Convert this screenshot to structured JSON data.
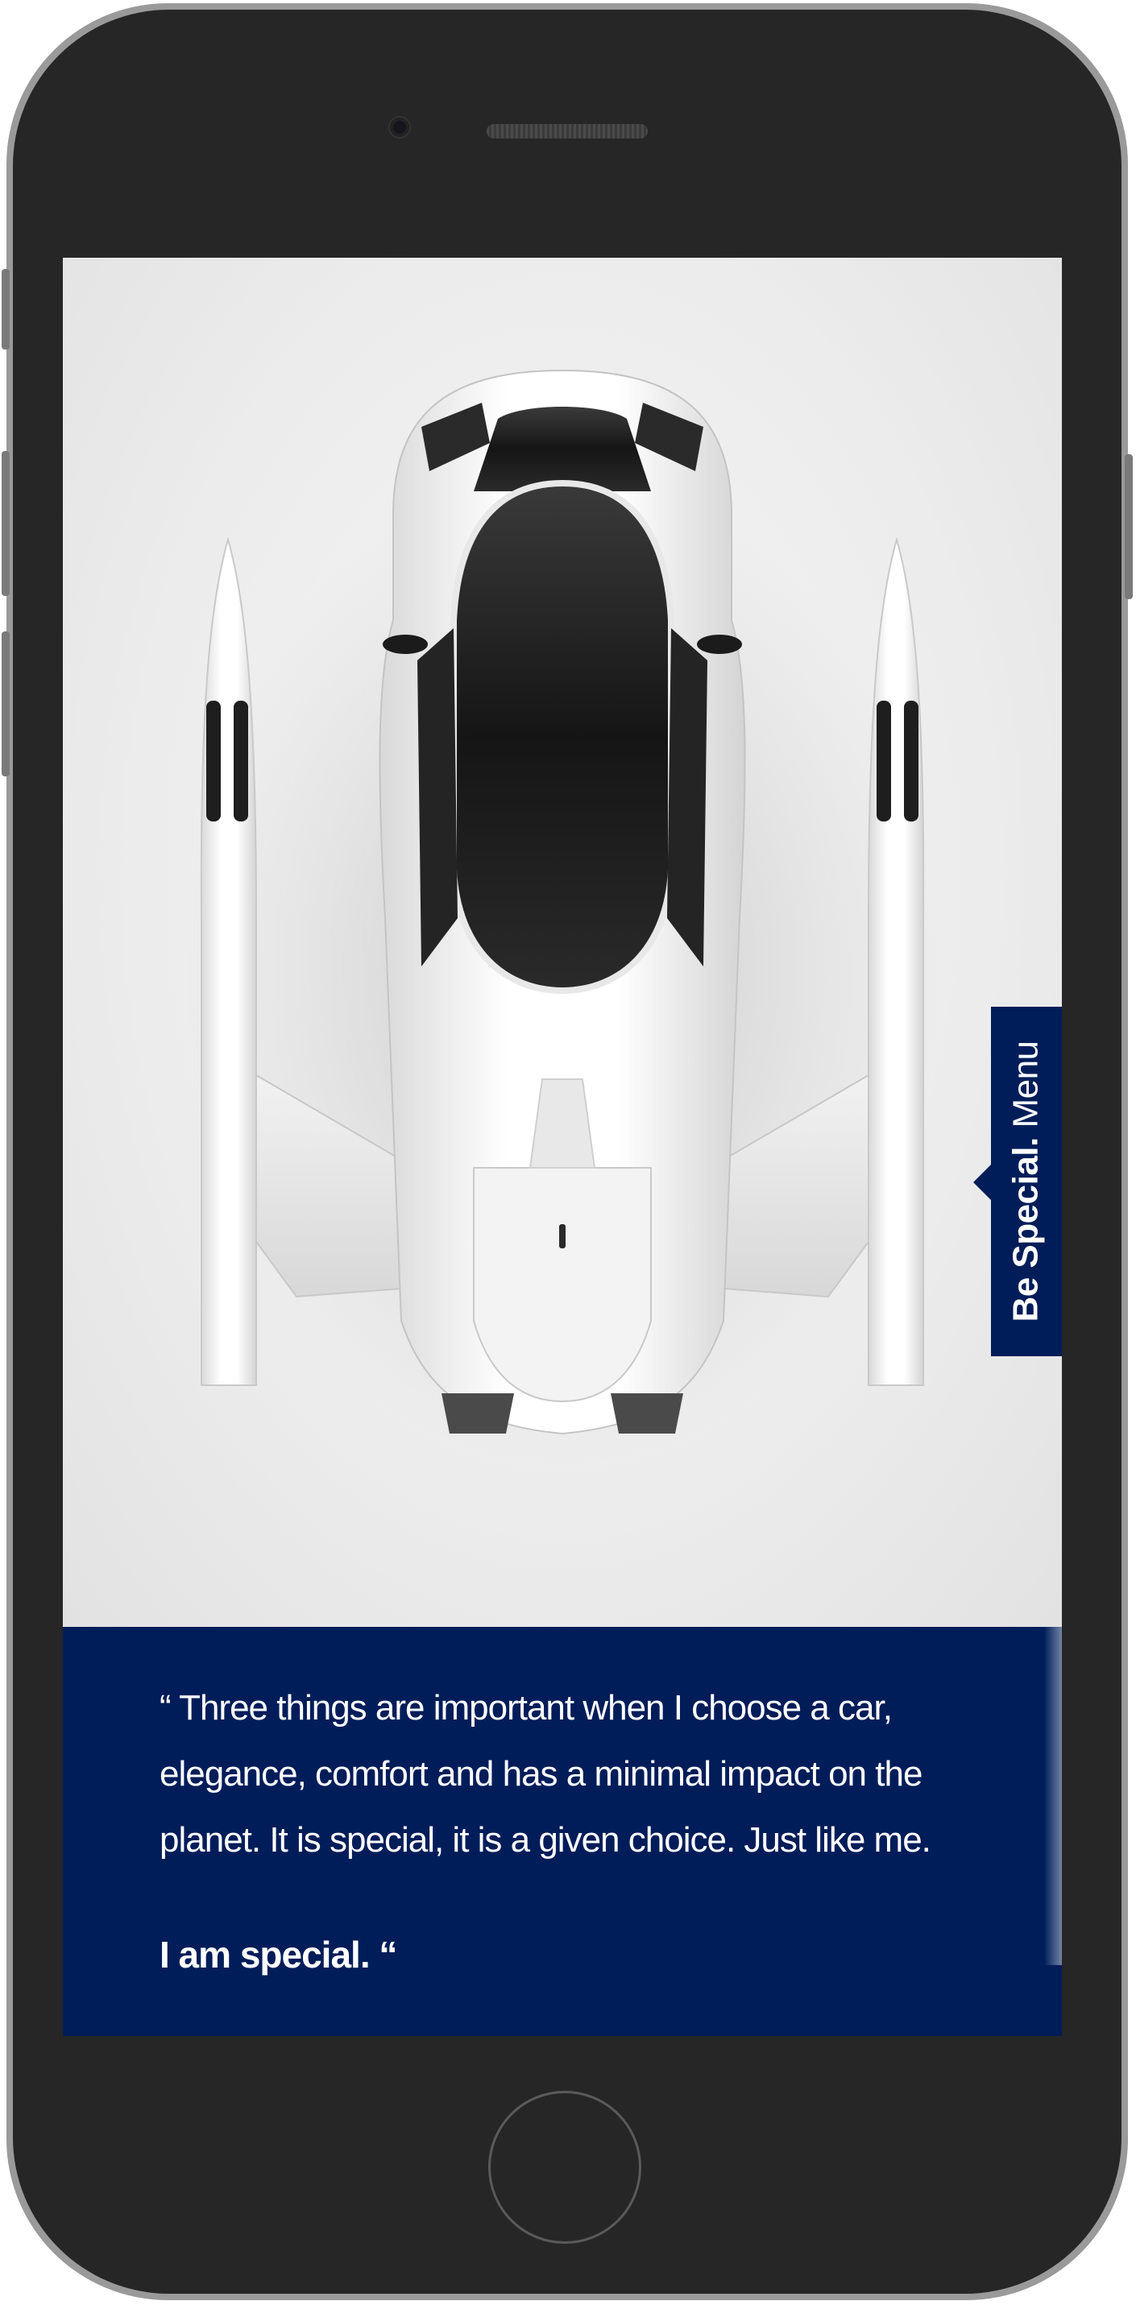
{
  "menu": {
    "brand_bold": "Be Special.",
    "label": "Menu"
  },
  "quote": {
    "text": "“ Three things are important when I choose a car, elegance, comfort and has a minimal impact on the planet. It is special, it is a given choice. Just like me.",
    "signoff": "I am special. “"
  },
  "colors": {
    "brand_navy": "#001d59",
    "hero_background": "#ebebeb",
    "device_body": "#262626"
  },
  "icons": {
    "hero_image": "flying-car-top-view",
    "tab_pointer": "triangle-left-icon"
  }
}
